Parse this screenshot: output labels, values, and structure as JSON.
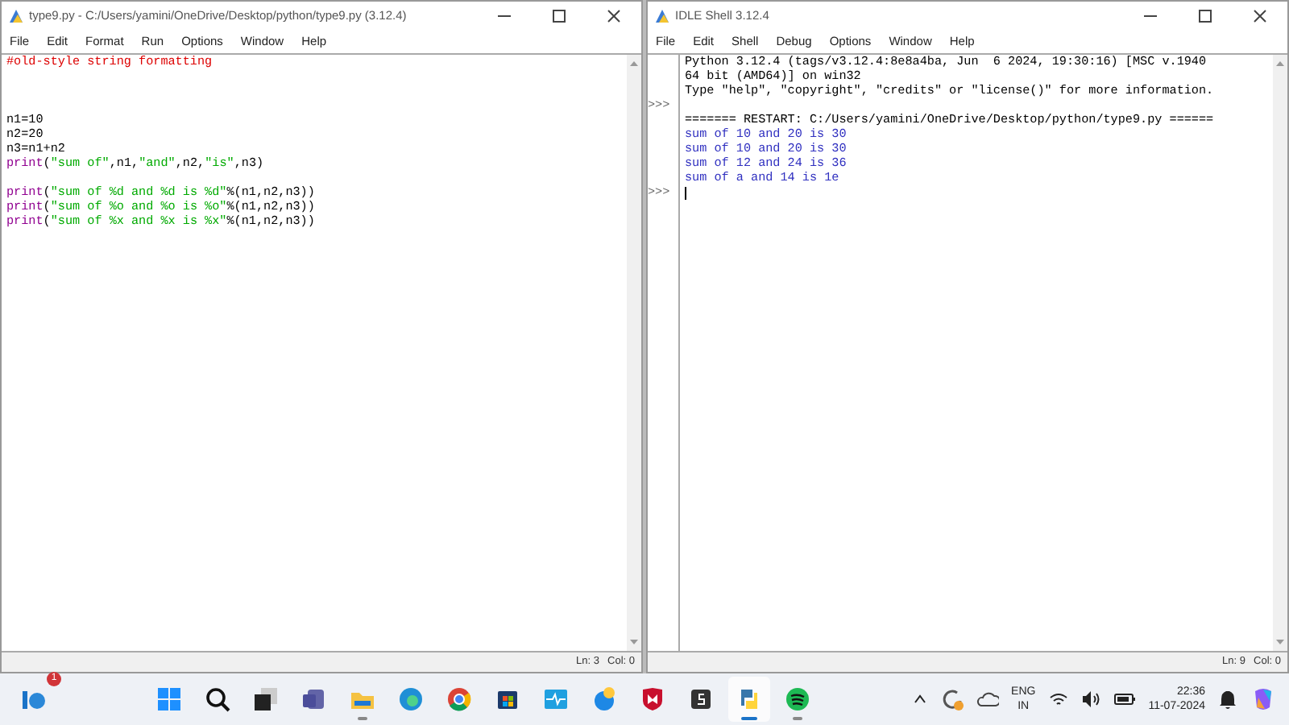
{
  "editor_window": {
    "title": "type9.py - C:/Users/yamini/OneDrive/Desktop/python/type9.py (3.12.4)",
    "menu": [
      "File",
      "Edit",
      "Format",
      "Run",
      "Options",
      "Window",
      "Help"
    ],
    "lines": [
      {
        "kind": "code",
        "segments": [
          {
            "text": "#old-style string formatting",
            "kind": "comment"
          }
        ]
      },
      {
        "kind": "blank"
      },
      {
        "kind": "blank"
      },
      {
        "kind": "blank"
      },
      {
        "kind": "code",
        "segments": [
          {
            "text": "n1=10",
            "kind": "plain"
          }
        ]
      },
      {
        "kind": "code",
        "segments": [
          {
            "text": "n2=20",
            "kind": "plain"
          }
        ]
      },
      {
        "kind": "code",
        "segments": [
          {
            "text": "n3=n1+n2",
            "kind": "plain"
          }
        ]
      },
      {
        "kind": "code",
        "segments": [
          {
            "text": "print",
            "kind": "builtin"
          },
          {
            "text": "(",
            "kind": "plain"
          },
          {
            "text": "\"sum of\"",
            "kind": "string"
          },
          {
            "text": ",n1,",
            "kind": "plain"
          },
          {
            "text": "\"and\"",
            "kind": "string"
          },
          {
            "text": ",n2,",
            "kind": "plain"
          },
          {
            "text": "\"is\"",
            "kind": "string"
          },
          {
            "text": ",n3)",
            "kind": "plain"
          }
        ]
      },
      {
        "kind": "blank"
      },
      {
        "kind": "code",
        "segments": [
          {
            "text": "print",
            "kind": "builtin"
          },
          {
            "text": "(",
            "kind": "plain"
          },
          {
            "text": "\"sum of %d and %d is %d\"",
            "kind": "string"
          },
          {
            "text": "%(n1,n2,n3))",
            "kind": "plain"
          }
        ]
      },
      {
        "kind": "code",
        "segments": [
          {
            "text": "print",
            "kind": "builtin"
          },
          {
            "text": "(",
            "kind": "plain"
          },
          {
            "text": "\"sum of %o and %o is %o\"",
            "kind": "string"
          },
          {
            "text": "%(n1,n2,n3))",
            "kind": "plain"
          }
        ]
      },
      {
        "kind": "code",
        "segments": [
          {
            "text": "print",
            "kind": "builtin"
          },
          {
            "text": "(",
            "kind": "plain"
          },
          {
            "text": "\"sum of %x and %x is %x\"",
            "kind": "string"
          },
          {
            "text": "%(n1,n2,n3))",
            "kind": "plain"
          }
        ]
      }
    ],
    "status": {
      "line": "Ln: 3",
      "col": "Col: 0"
    }
  },
  "shell_window": {
    "title": "IDLE Shell 3.12.4",
    "menu": [
      "File",
      "Edit",
      "Shell",
      "Debug",
      "Options",
      "Window",
      "Help"
    ],
    "lines": [
      {
        "kind": "info",
        "text": "Python 3.12.4 (tags/v3.12.4:8e8a4ba, Jun  6 2024, 19:30:16) [MSC v.1940"
      },
      {
        "kind": "info",
        "text": "64 bit (AMD64)] on win32"
      },
      {
        "kind": "info",
        "text": "Type \"help\", \"copyright\", \"credits\" or \"license()\" for more information."
      },
      {
        "kind": "prompt",
        "prompt": ">>>"
      },
      {
        "kind": "info",
        "text": "======= RESTART: C:/Users/yamini/OneDrive/Desktop/python/type9.py ======"
      },
      {
        "kind": "output",
        "text": "sum of 10 and 20 is 30"
      },
      {
        "kind": "output",
        "text": "sum of 10 and 20 is 30"
      },
      {
        "kind": "output",
        "text": "sum of 12 and 24 is 36"
      },
      {
        "kind": "output",
        "text": "sum of a and 14 is 1e"
      },
      {
        "kind": "input",
        "prompt": ">>>"
      }
    ],
    "status": {
      "line": "Ln: 9",
      "col": "Col: 0"
    }
  },
  "taskbar": {
    "widget_badge": "1",
    "apps": [
      {
        "kind": "start",
        "running": false,
        "selected": false
      },
      {
        "kind": "search",
        "running": false,
        "selected": false
      },
      {
        "kind": "taskview",
        "running": false,
        "selected": false
      },
      {
        "kind": "teams",
        "running": false,
        "selected": false
      },
      {
        "kind": "folder",
        "running": true,
        "selected": false
      },
      {
        "kind": "edge",
        "running": false,
        "selected": false
      },
      {
        "kind": "chrome",
        "running": false,
        "selected": false
      },
      {
        "kind": "store",
        "running": false,
        "selected": false
      },
      {
        "kind": "pulse",
        "running": false,
        "selected": false
      },
      {
        "kind": "paint",
        "running": false,
        "selected": false
      },
      {
        "kind": "shield",
        "running": false,
        "selected": false
      },
      {
        "kind": "sapp",
        "running": false,
        "selected": false
      },
      {
        "kind": "python",
        "running": true,
        "selected": true
      },
      {
        "kind": "music",
        "running": true,
        "selected": false
      }
    ],
    "language": "ENG",
    "region": "IN",
    "time": "22:36",
    "date": "11-07-2024"
  }
}
